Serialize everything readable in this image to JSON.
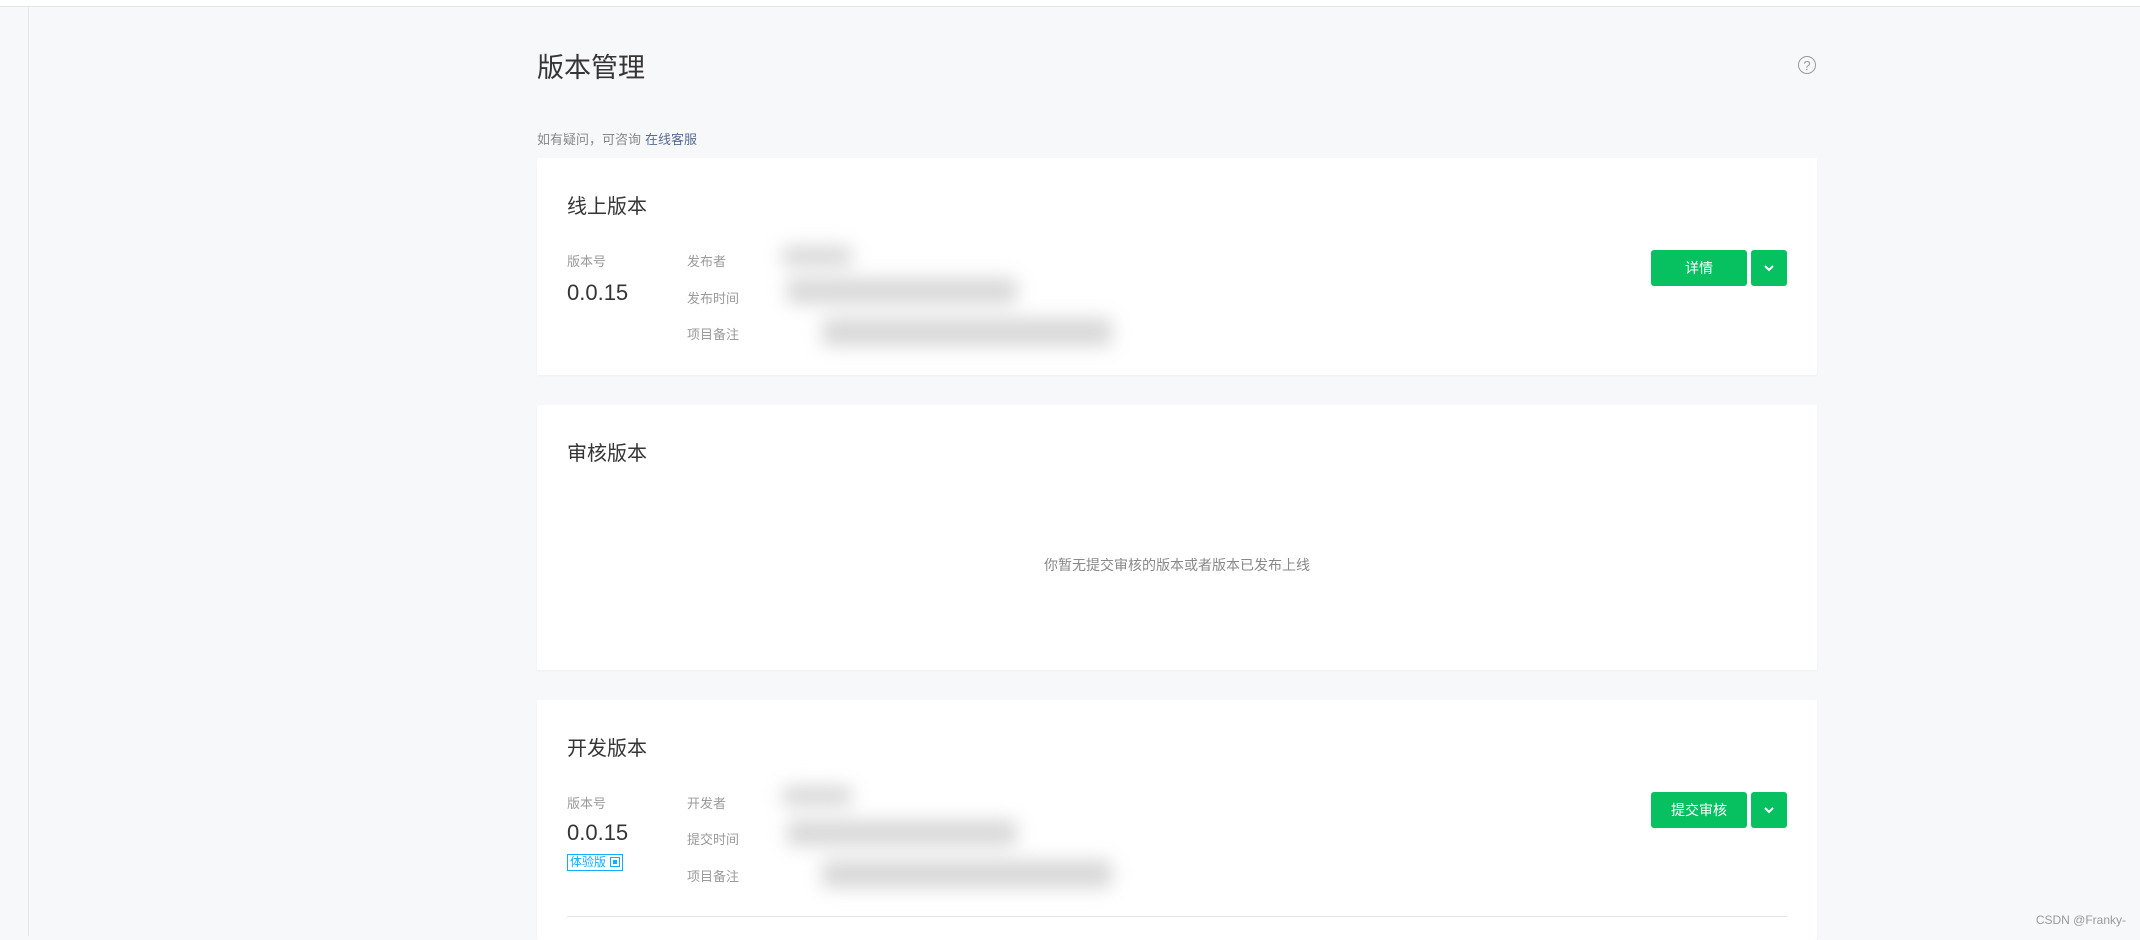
{
  "page": {
    "title": "版本管理",
    "help_icon": "question-circle-icon",
    "inquiry_text": "如有疑问，可咨询",
    "inquiry_link": "在线客服"
  },
  "online": {
    "title": "线上版本",
    "version_label": "版本号",
    "version": "0.0.15",
    "meta_labels": [
      "发布者",
      "发布时间",
      "项目备注"
    ],
    "detail_button": "详情"
  },
  "review": {
    "title": "审核版本",
    "empty_message": "你暂无提交审核的版本或者版本已发布上线"
  },
  "dev": {
    "title": "开发版本",
    "version_label": "版本号",
    "version": "0.0.15",
    "badge": "体验版",
    "meta_labels": [
      "开发者",
      "提交时间",
      "项目备注"
    ],
    "submit_button": "提交审核"
  },
  "watermark": "CSDN @Franky-",
  "colors": {
    "primary": "#07c160",
    "link": "#576b95",
    "badge": "#10aeff"
  }
}
